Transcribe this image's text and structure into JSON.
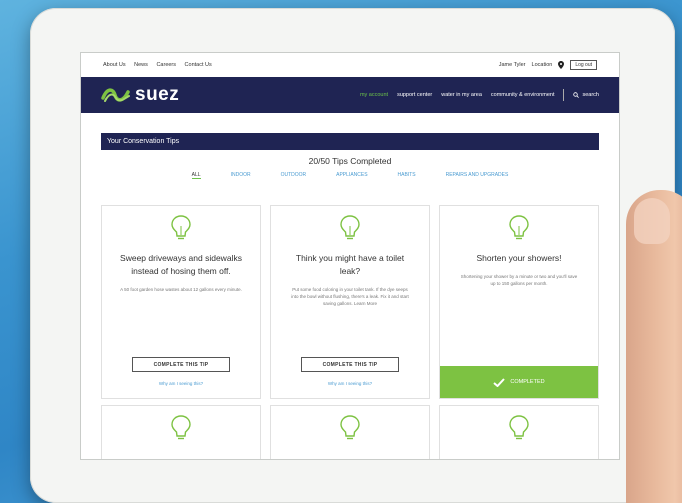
{
  "topbar": {
    "links": [
      "About Us",
      "News",
      "Careers",
      "Contact Us"
    ],
    "user_name": "Jame Tyler",
    "location_label": "Location",
    "logout_label": "Log out"
  },
  "brand": {
    "logo_text": "suez"
  },
  "nav": {
    "items": [
      "my account",
      "support center",
      "water in my area",
      "community & environment"
    ],
    "active_index": 0,
    "search_label": "search"
  },
  "section": {
    "title": "Your Conservation Tips",
    "progress": "20/50 Tips Completed"
  },
  "filters": {
    "items": [
      "ALL",
      "INDOOR",
      "OUTDOOR",
      "APPLIANCES",
      "HABITS",
      "REPAIRS AND UPGRADES"
    ],
    "selected_index": 0
  },
  "cards": [
    {
      "title": "Sweep driveways and sidewalks instead of hosing them off.",
      "body": "A 50 foot garden hose wastes about 12 gallons every minute.",
      "button_label": "COMPLETE THIS TIP",
      "why_label": "Why am I seeing this?"
    },
    {
      "title": "Think you might have a toilet leak?",
      "body": "Put some food coloring in your toilet tank. If the dye seeps into the bowl without flushing, there's a leak. Fix it and start saving gallons. Learn More",
      "button_label": "COMPLETE THIS TIP",
      "why_label": "Why am I seeing this?"
    },
    {
      "title": "Shorten your showers!",
      "body": "Shortening your shower by a minute or two and you'll save up to 150 gallons per month.",
      "completed_label": "COMPLETED"
    }
  ],
  "colors": {
    "navy": "#1f2453",
    "accent_green": "#7dc242",
    "link_blue": "#4a9bd1"
  }
}
